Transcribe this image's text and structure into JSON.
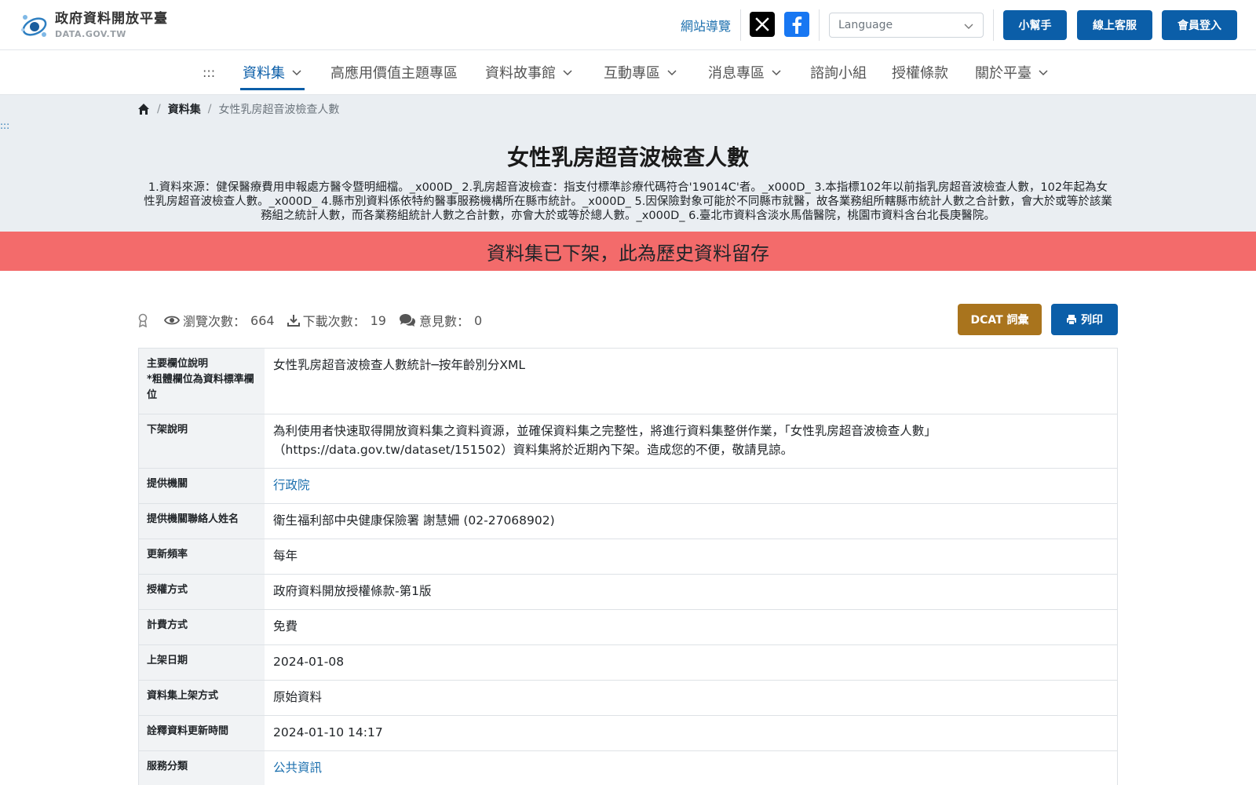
{
  "header": {
    "logo_title": "政府資料開放平臺",
    "logo_sub": "DATA.GOV.TW",
    "sitemap_label": "網站導覽",
    "language_placeholder": "Language",
    "buttons": {
      "helper": "小幫手",
      "support": "線上客服",
      "login": "會員登入"
    },
    "colors": {
      "primary": "#0b5ea8",
      "x_brand": "#000000",
      "facebook_brand": "#1877f2"
    }
  },
  "nav": {
    "accesskey": ":::",
    "items": [
      {
        "label": "資料集",
        "has_dropdown": true,
        "active": true
      },
      {
        "label": "高應用價值主題專區",
        "has_dropdown": false
      },
      {
        "label": "資料故事館",
        "has_dropdown": true
      },
      {
        "label": "互動專區",
        "has_dropdown": true
      },
      {
        "label": "消息專區",
        "has_dropdown": true
      },
      {
        "label": "諮詢小組",
        "has_dropdown": false
      },
      {
        "label": "授權條款",
        "has_dropdown": false
      },
      {
        "label": "關於平臺",
        "has_dropdown": true
      }
    ]
  },
  "breadcrumb": {
    "home_icon": "home-icon",
    "items": [
      "資料集",
      "女性乳房超音波檢查人數"
    ]
  },
  "content_accesskey": ":::",
  "page": {
    "title": "女性乳房超音波檢查人數",
    "description": "1.資料來源：健保醫療費用申報處方醫令暨明細檔。_x000D_ 2.乳房超音波檢查：指支付標準診療代碼符合'19014C'者。_x000D_ 3.本指標102年以前指乳房超音波檢查人數，102年起為女性乳房超音波檢查人數。_x000D_ 4.縣市別資料係依特約醫事服務機構所在縣市統計。_x000D_ 5.因保險對象可能於不同縣市就醫，故各業務組所轄縣市統計人數之合計數，會大於或等於該業務組之統計人數，而各業務組統計人數之合計數，亦會大於或等於總人數。_x000D_ 6.臺北市資料含淡水馬偕醫院，桃園市資料含台北長庚醫院。",
    "banner": "資料集已下架，此為歷史資料留存",
    "banner_color": "#f36b6b"
  },
  "stats": {
    "views_label": "瀏覽次數：",
    "views": "664",
    "downloads_label": "下載次數：",
    "downloads": "19",
    "comments_label": "意見數：",
    "comments": "0"
  },
  "actions": {
    "dcat": "DCAT 詞彙",
    "print": "列印",
    "dcat_color": "#a9741d"
  },
  "table": {
    "main_field_label": "主要欄位說明",
    "main_field_note": "*粗體欄位為資料標準欄位",
    "main_field_value": "女性乳房超音波檢查人數統計─按年齡別分XML",
    "rows": [
      {
        "label": "下架說明",
        "value": "為利使用者快速取得開放資料集之資料資源，並確保資料集之完整性，將進行資料集整併作業，「女性乳房超音波檢查人數」（https://data.gov.tw/dataset/151502）資料集將於近期內下架。造成您的不便，敬請見諒。"
      },
      {
        "label": "提供機關",
        "value": "行政院",
        "link": true
      },
      {
        "label": "提供機關聯絡人姓名",
        "value": "衛生福利部中央健康保險署 謝慧姍 (02-27068902)"
      },
      {
        "label": "更新頻率",
        "value": "每年"
      },
      {
        "label": "授權方式",
        "value": "政府資料開放授權條款-第1版"
      },
      {
        "label": "計費方式",
        "value": "免費"
      },
      {
        "label": "上架日期",
        "value": "2024-01-08"
      },
      {
        "label": "資料集上架方式",
        "value": "原始資料"
      },
      {
        "label": "詮釋資料更新時間",
        "value": "2024-01-10 14:17"
      },
      {
        "label": "服務分類",
        "value": "公共資訊",
        "link": true
      }
    ]
  }
}
